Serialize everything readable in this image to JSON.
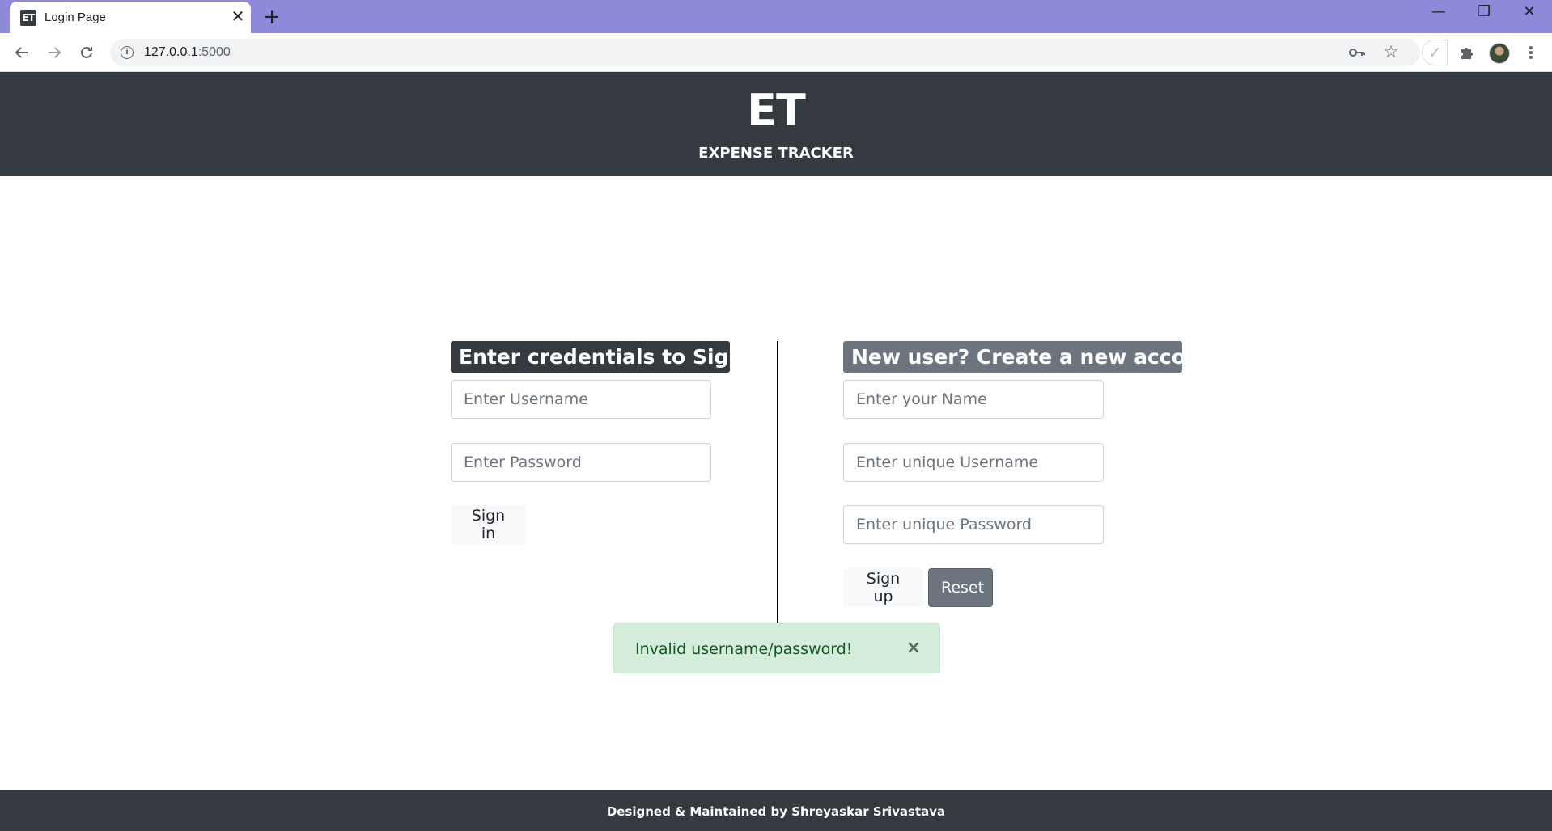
{
  "browser": {
    "tab": {
      "favicon_text": "ET",
      "title": "Login Page",
      "close_glyph": "✕"
    },
    "new_tab_glyph": "+",
    "window_controls": {
      "minimize": "—",
      "restore": "❐",
      "close": "✕"
    },
    "url": {
      "host": "127.0.0.1",
      "port": ":5000"
    },
    "toolbar_icons": [
      "back-icon",
      "forward-icon",
      "reload-icon",
      "site-info-icon",
      "key-icon",
      "star-icon",
      "check-extension-icon",
      "puzzle-icon",
      "avatar",
      "menu-icon"
    ]
  },
  "header": {
    "logo": "ET",
    "subtitle": "EXPENSE TRACKER"
  },
  "signin": {
    "title": "Enter credentials to Signin",
    "username_placeholder": "Enter Username",
    "password_placeholder": "Enter Password",
    "button": "Sign in"
  },
  "signup": {
    "title": "New user? Create a new account",
    "name_placeholder": "Enter your Name",
    "username_placeholder": "Enter unique Username",
    "password_placeholder": "Enter unique Password",
    "signup_button": "Sign up",
    "reset_button": "Reset"
  },
  "alert": {
    "message": "Invalid username/password!",
    "close_glyph": "×"
  },
  "footer": {
    "prefix": "Designed & Maintained by ",
    "author": "Shreyaskar Srivastava"
  },
  "colors": {
    "tabstrip": "#8e89d9",
    "dark": "#343a40",
    "secondary": "#6c757d",
    "alert_bg": "#d4edda",
    "alert_text": "#155724"
  }
}
